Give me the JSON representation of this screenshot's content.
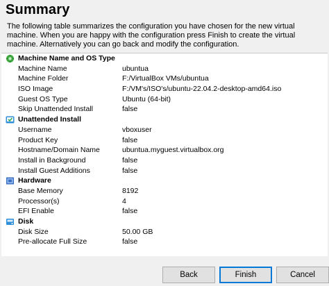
{
  "header": {
    "title": "Summary",
    "description": "The following table summarizes the configuration you have chosen for the new virtual machine. When you are happy with the configuration press Finish to create the virtual machine. Alternatively you can go back and modify the configuration."
  },
  "sections": [
    {
      "label": "Machine Name and OS Type",
      "icon": "gear-star-icon",
      "rows": [
        {
          "key": "Machine Name",
          "value": "ubuntua"
        },
        {
          "key": "Machine Folder",
          "value": "F:/VirtualBox VMs/ubuntua"
        },
        {
          "key": "ISO Image",
          "value": "F:/VM's/ISO's/ubuntu-22.04.2-desktop-amd64.iso"
        },
        {
          "key": "Guest OS Type",
          "value": "Ubuntu (64-bit)"
        },
        {
          "key": "Skip Unattended Install",
          "value": "false"
        }
      ]
    },
    {
      "label": "Unattended Install",
      "icon": "install-icon",
      "rows": [
        {
          "key": "Username",
          "value": "vboxuser"
        },
        {
          "key": "Product Key",
          "value": "false"
        },
        {
          "key": "Hostname/Domain Name",
          "value": "ubuntua.myguest.virtualbox.org"
        },
        {
          "key": "Install in Background",
          "value": "false"
        },
        {
          "key": "Install Guest Additions",
          "value": "false"
        }
      ]
    },
    {
      "label": "Hardware",
      "icon": "hardware-icon",
      "rows": [
        {
          "key": "Base Memory",
          "value": "8192"
        },
        {
          "key": "Processor(s)",
          "value": "4"
        },
        {
          "key": "EFI Enable",
          "value": "false"
        }
      ]
    },
    {
      "label": "Disk",
      "icon": "disk-icon",
      "rows": [
        {
          "key": "Disk Size",
          "value": "50.00 GB"
        },
        {
          "key": "Pre-allocate Full Size",
          "value": "false"
        }
      ]
    }
  ],
  "buttons": {
    "back": "Back",
    "finish": "Finish",
    "cancel": "Cancel"
  },
  "colors": {
    "panel_bg": "#ffffff",
    "window_bg": "#f0f0f0",
    "primary_border": "#0078d7"
  }
}
